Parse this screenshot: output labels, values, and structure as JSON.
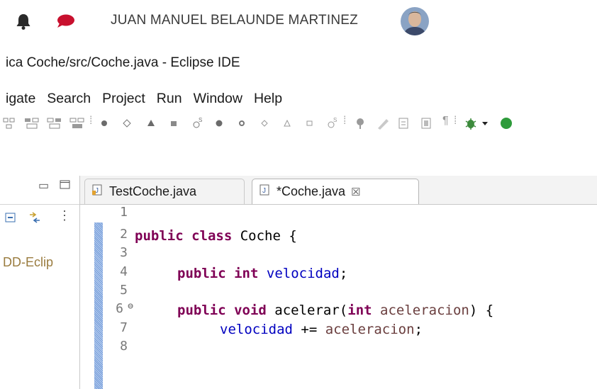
{
  "user": {
    "name": "JUAN MANUEL BELAUNDE MARTINEZ"
  },
  "window": {
    "title": "ica Coche/src/Coche.java - Eclipse IDE"
  },
  "menu": {
    "items": [
      {
        "label": "igate"
      },
      {
        "label": "Search"
      },
      {
        "label": "Project"
      },
      {
        "label": "Run"
      },
      {
        "label": "Window"
      },
      {
        "label": "Help"
      }
    ]
  },
  "left_panel": {
    "tree_item": "DD-Eclip"
  },
  "editor": {
    "tabs": [
      {
        "label": "TestCoche.java",
        "active": false
      },
      {
        "label": "*Coche.java",
        "active": true,
        "close": "☒"
      }
    ],
    "line_numbers": [
      "1",
      "2",
      "3",
      "4",
      "5",
      "6",
      "7",
      "8"
    ],
    "fold_marker": "⊖",
    "code": {
      "l2_kw1": "public",
      "l2_kw2": "class",
      "l2_rest": " Coche {",
      "l4_kw1": "public",
      "l4_kw2": "int",
      "l4_field": "velocidad",
      "l4_rest": ";",
      "l6_kw1": "public",
      "l6_kw2": "void",
      "l6_name": " acelerar(",
      "l6_kw3": "int",
      "l6_param": "aceleracion",
      "l6_rest": ") {",
      "l7_field": "velocidad",
      "l7_op": " += ",
      "l7_param": "aceleracion",
      "l7_rest": ";"
    }
  },
  "colors": {
    "keyword": "#7f0055",
    "field": "#0000c0",
    "local_var": "#6a3e3e",
    "tree_text": "#9a7c3f",
    "change_bar": "#5f8dd3"
  }
}
